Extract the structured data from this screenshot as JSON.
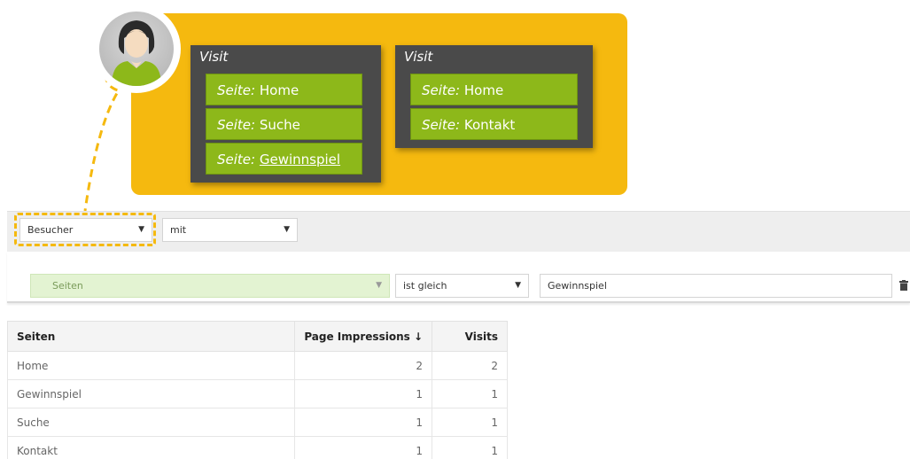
{
  "diagram": {
    "visits": [
      {
        "title": "Visit",
        "pages": [
          {
            "prefix": "Seite:",
            "name": "Home"
          },
          {
            "prefix": "Seite:",
            "name": "Suche"
          },
          {
            "prefix": "Seite:",
            "name": "Gewinnspiel"
          }
        ]
      },
      {
        "title": "Visit",
        "pages": [
          {
            "prefix": "Seite:",
            "name": "Home"
          },
          {
            "prefix": "Seite:",
            "name": "Kontakt"
          }
        ]
      }
    ],
    "colors": {
      "panel": "#f5b90f",
      "visit_box": "#4a4a4a",
      "page_chip": "#8db81a"
    }
  },
  "filter": {
    "subject": "Besucher",
    "relation": "mit",
    "condition": {
      "field": "Seiten",
      "operator": "ist gleich",
      "value": "Gewinnspiel"
    }
  },
  "table": {
    "headers": [
      "Seiten",
      "Page Impressions",
      "Visits"
    ],
    "sort_indicator": "↓",
    "rows": [
      {
        "page": "Home",
        "impressions": "2",
        "visits": "2"
      },
      {
        "page": "Gewinnspiel",
        "impressions": "1",
        "visits": "1"
      },
      {
        "page": "Suche",
        "impressions": "1",
        "visits": "1"
      },
      {
        "page": "Kontakt",
        "impressions": "1",
        "visits": "1"
      }
    ]
  }
}
